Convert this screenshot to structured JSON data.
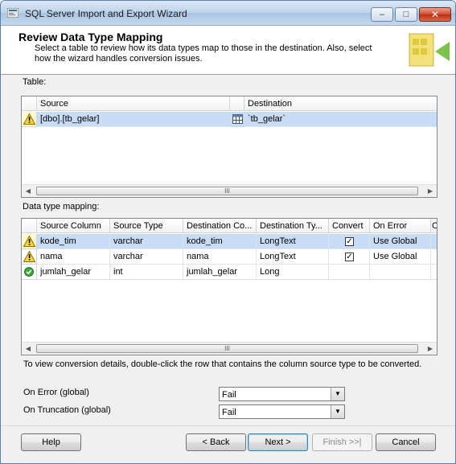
{
  "window": {
    "title": "SQL Server Import and Export Wizard",
    "minimize": "–",
    "maximize": "□",
    "close": "✕"
  },
  "header": {
    "title": "Review Data Type Mapping",
    "description": "Select a table to review how its data types map to those in the destination. Also, select how the wizard handles conversion issues."
  },
  "tables": {
    "label": "Table:",
    "columns": [
      "Source",
      "Destination"
    ],
    "rows": [
      {
        "status_icon": "warning-icon",
        "source": "[dbo].[tb_gelar]",
        "dest_icon": "table-icon",
        "destination": "`tb_gelar`"
      }
    ],
    "scroll_grip": "III"
  },
  "mapping": {
    "label": "Data type mapping:",
    "columns": [
      "Source Column",
      "Source Type",
      "Destination Co...",
      "Destination Ty...",
      "Convert",
      "On Error",
      "O"
    ],
    "rows": [
      {
        "status_icon": "warning-icon",
        "source_column": "kode_tim",
        "source_type": "varchar",
        "destination_column": "kode_tim",
        "destination_type": "LongText",
        "convert": true,
        "on_error": "Use Global"
      },
      {
        "status_icon": "warning-icon",
        "source_column": "nama",
        "source_type": "varchar",
        "destination_column": "nama",
        "destination_type": "LongText",
        "convert": true,
        "on_error": "Use Global"
      },
      {
        "status_icon": "ok-icon",
        "source_column": "jumlah_gelar",
        "source_type": "int",
        "destination_column": "jumlah_gelar",
        "destination_type": "Long",
        "convert": false,
        "on_error": ""
      }
    ],
    "scroll_grip": "III"
  },
  "hint": "To view conversion details, double-click the row that contains the column source type to be converted.",
  "global": {
    "on_error_label": "On Error (global)",
    "on_error_value": "Fail",
    "on_truncation_label": "On Truncation (global)",
    "on_truncation_value": "Fail"
  },
  "buttons": {
    "help": "Help",
    "back": "< Back",
    "next": "Next >",
    "finish": "Finish >>|",
    "cancel": "Cancel"
  },
  "colors": {
    "selected_row": "#c9dcf5",
    "warning_yellow": "#f7d634",
    "ok_green": "#3aa83a"
  }
}
